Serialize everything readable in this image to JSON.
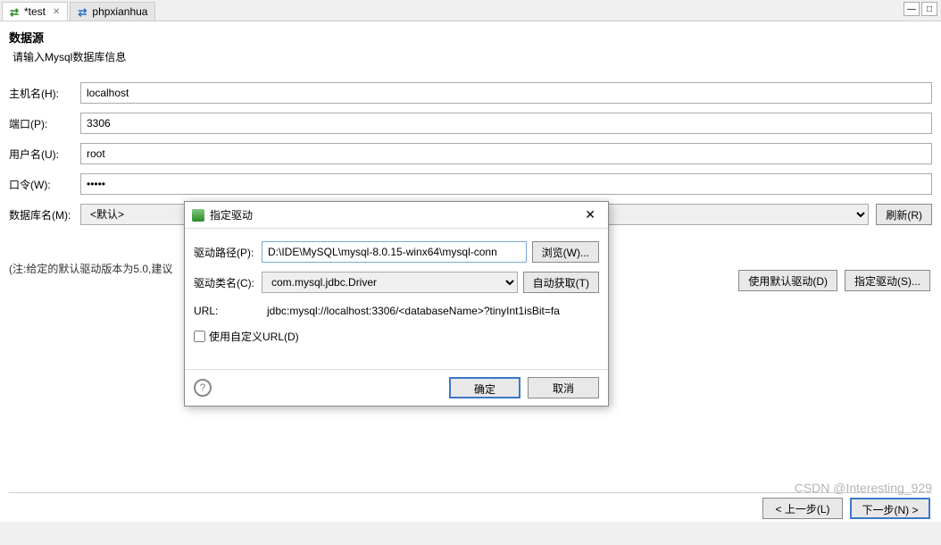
{
  "tabs": {
    "active": {
      "label": "*test"
    },
    "inactive": {
      "label": "phpxianhua"
    }
  },
  "section": {
    "title": "数据源",
    "subtitle": "请输入Mysql数据库信息"
  },
  "form": {
    "host_label": "主机名(H):",
    "host_value": "localhost",
    "port_label": "端口(P):",
    "port_value": "3306",
    "user_label": "用户名(U):",
    "user_value": "root",
    "password_label": "口令(W):",
    "password_value": "•••••",
    "db_label": "数据库名(M):",
    "db_value": "<默认>",
    "refresh_label": "刷新(R)"
  },
  "note": "(注:给定的默认驱动版本为5.0,建议",
  "right_buttons": {
    "use_default": "使用默认驱动(D)",
    "specify": "指定驱动(S)..."
  },
  "dialog": {
    "title": "指定驱动",
    "driver_path_label": "驱动路径(P):",
    "driver_path_value": "D:\\IDE\\MySQL\\mysql-8.0.15-winx64\\mysql-conn",
    "browse_label": "浏览(W)...",
    "driver_class_label": "驱动类名(C):",
    "driver_class_value": "com.mysql.jdbc.Driver",
    "auto_fetch_label": "自动获取(T)",
    "url_label": "URL:",
    "url_value": "jdbc:mysql://localhost:3306/<databaseName>?tinyInt1isBit=fa",
    "custom_url_label": "使用自定义URL(D)",
    "ok_label": "确定",
    "cancel_label": "取消"
  },
  "wizard": {
    "back_label": "< 上一步(L)",
    "next_label": "下一步(N) >"
  },
  "watermark": "CSDN @Interesting_929"
}
